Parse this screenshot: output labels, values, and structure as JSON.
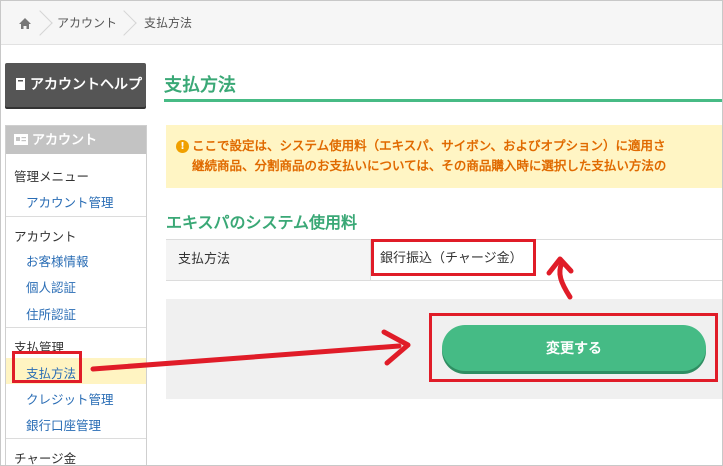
{
  "breadcrumb": {
    "home_icon": "home-icon",
    "items": [
      "アカウント",
      "支払方法"
    ]
  },
  "sidebar": {
    "help_button": "アカウントヘルプ",
    "help_icon": "book-icon",
    "panel_title": "アカウント",
    "panel_icon": "id-card-icon",
    "groups": [
      {
        "title": "管理メニュー",
        "links": [
          "アカウント管理"
        ]
      },
      {
        "title": "アカウント",
        "links": [
          "お客様情報",
          "個人認証",
          "住所認証"
        ]
      },
      {
        "title": "支払管理",
        "links": [
          "支払方法",
          "クレジット管理",
          "銀行口座管理"
        ]
      },
      {
        "title": "チャージ金",
        "links": []
      }
    ],
    "active_link": "支払方法"
  },
  "main": {
    "title": "支払方法",
    "notice": {
      "icon": "exclamation-icon",
      "line1": "ここで設定は、システム使用料（エキスパ、サイボン、およびオプション）に適用さ",
      "line2": "継続商品、分割商品のお支払いについては、その商品購入時に選択した支払い方法の"
    },
    "section_title": "エキスパのシステム使用料",
    "table": {
      "label": "支払方法",
      "value": "銀行振込（チャージ金）"
    },
    "change_button": "変更する"
  },
  "colors": {
    "accent": "#45bb85",
    "highlight_red": "#e01c28",
    "notice_bg": "#fff5c4",
    "notice_text": "#e06a00"
  }
}
